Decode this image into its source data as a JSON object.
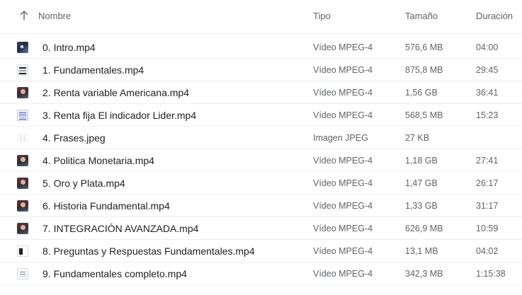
{
  "header": {
    "name_label": "Nombre",
    "type_label": "Tipo",
    "size_label": "Tamaño",
    "duration_label": "Duración",
    "sort_icon": "arrow-up-icon"
  },
  "files": [
    {
      "name": "0. Intro.mp4",
      "type": "Vídeo MPEG-4",
      "size": "576,6 MB",
      "duration": "04:00",
      "thumb": "t-video-dark"
    },
    {
      "name": "1. Fundamentales.mp4",
      "type": "Vídeo MPEG-4",
      "size": "875,8 MB",
      "duration": "29:45",
      "thumb": "t-video-light"
    },
    {
      "name": "2. Renta variable Americana.mp4",
      "type": "Vídeo MPEG-4",
      "size": "1,56 GB",
      "duration": "36:41",
      "thumb": "t-person"
    },
    {
      "name": "3. Renta fija El indicador Lider.mp4",
      "type": "Vídeo MPEG-4",
      "size": "568,5 MB",
      "duration": "15:23",
      "thumb": "t-slides"
    },
    {
      "name": "4. Frases.jpeg",
      "type": "Imagen JPEG",
      "size": "27 KB",
      "duration": "",
      "thumb": "t-image"
    },
    {
      "name": "4. Politica Monetaria.mp4",
      "type": "Vídeo MPEG-4",
      "size": "1,18 GB",
      "duration": "27:41",
      "thumb": "t-person"
    },
    {
      "name": "5. Oro y Plata.mp4",
      "type": "Vídeo MPEG-4",
      "size": "1,47 GB",
      "duration": "26:17",
      "thumb": "t-person"
    },
    {
      "name": "6. Historia Fundamental.mp4",
      "type": "Vídeo MPEG-4",
      "size": "1,33 GB",
      "duration": "31:17",
      "thumb": "t-person"
    },
    {
      "name": "7. INTEGRACIÓN AVANZADA.mp4",
      "type": "Vídeo MPEG-4",
      "size": "626,9 MB",
      "duration": "10:59",
      "thumb": "t-person"
    },
    {
      "name": "8. Preguntas y Respuestas Fundamentales.mp4",
      "type": "Vídeo MPEG-4",
      "size": "13,1 MB",
      "duration": "04:02",
      "thumb": "t-dark-doc"
    },
    {
      "name": "9. Fundamentales completo.mp4",
      "type": "Vídeo MPEG-4",
      "size": "342,3 MB",
      "duration": "1:15:38",
      "thumb": "t-doc"
    }
  ]
}
